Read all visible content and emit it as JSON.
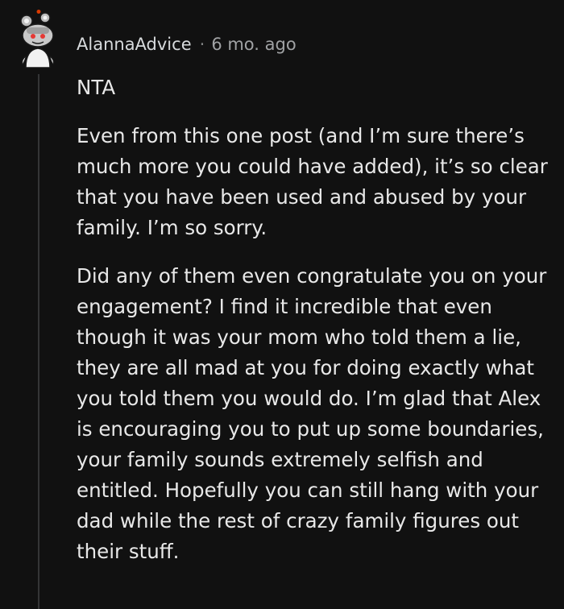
{
  "comment": {
    "username": "AlannaAdvice",
    "separator": "·",
    "timestamp": "6 mo. ago",
    "paragraphs": [
      "NTA",
      "Even from this one post (and I’m sure there’s much more you could have added), it’s so clear that you have been used and abused by your family. I’m so sorry.",
      "Did any of them even congratulate you on your engagement? I find it incredible that even though it was your mom who told them a lie, they are all mad at you for doing exactly what you told them you would do. I’m glad that Alex is encouraging you to put up some boundaries, your family sounds extremely selfish and entitled. Hopefully you can still hang with your dad while the rest of crazy family figures out their stuff."
    ]
  },
  "colors": {
    "background": "#111111",
    "thread_line": "#343536",
    "text": "#e8e8e8",
    "meta": "#a0a2a4"
  },
  "icons": {
    "avatar": "snoo-avatar-icon"
  }
}
